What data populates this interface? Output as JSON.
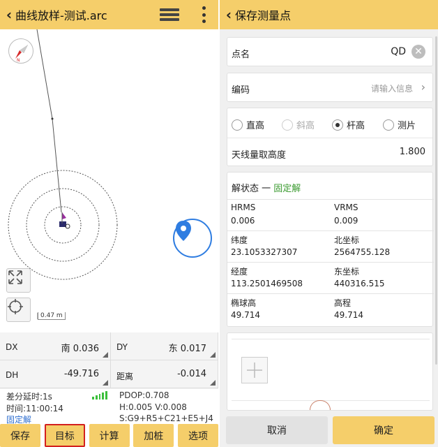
{
  "left": {
    "title": "曲线放样-测试.arc",
    "scale": "0.47 m",
    "stats": {
      "dx_label": "DX",
      "dx_value": "南 0.036",
      "dy_label": "DY",
      "dy_value": "东 0.017",
      "dh_label": "DH",
      "dh_value": "-49.716",
      "dist_label": "距离",
      "dist_value": "-0.014"
    },
    "info": {
      "diff_delay": "差分延时:1s",
      "time": "时间:11:00:14",
      "solution": "固定解",
      "pdop": "PDOP:0.708",
      "hv": "H:0.005  V:0.008",
      "sats": "S:G9+R5+C21+E5+J4"
    },
    "bottom_buttons": [
      "保存",
      "目标",
      "计算",
      "加桩",
      "选项"
    ],
    "selected_button": "目标"
  },
  "right": {
    "title": "保存测量点",
    "point_name_label": "点名",
    "point_name_value": "QD",
    "code_label": "编码",
    "code_placeholder": "请输入信息",
    "height_types": [
      "直高",
      "斜高",
      "杆高",
      "测片"
    ],
    "selected_height_type": "杆高",
    "antenna_label": "天线量取高度",
    "antenna_value": "1.800",
    "status_label": "解状态 一",
    "status_value": "固定解",
    "grid": [
      {
        "label": "HRMS",
        "value": "0.006"
      },
      {
        "label": "VRMS",
        "value": "0.009"
      },
      {
        "label": "纬度",
        "value": "23.1053327307"
      },
      {
        "label": "北坐标",
        "value": "2564755.128"
      },
      {
        "label": "经度",
        "value": "113.2501469508"
      },
      {
        "label": "东坐标",
        "value": "440316.515"
      },
      {
        "label": "椭球高",
        "value": "49.714"
      },
      {
        "label": "高程",
        "value": "49.714"
      }
    ],
    "cancel_label": "取消",
    "confirm_label": "确定"
  },
  "colors": {
    "accent": "#f5ce6a",
    "fixed_solution": "#3a9a2f",
    "locate_blue": "#2f7de1",
    "selected_outline": "#d3201f"
  }
}
